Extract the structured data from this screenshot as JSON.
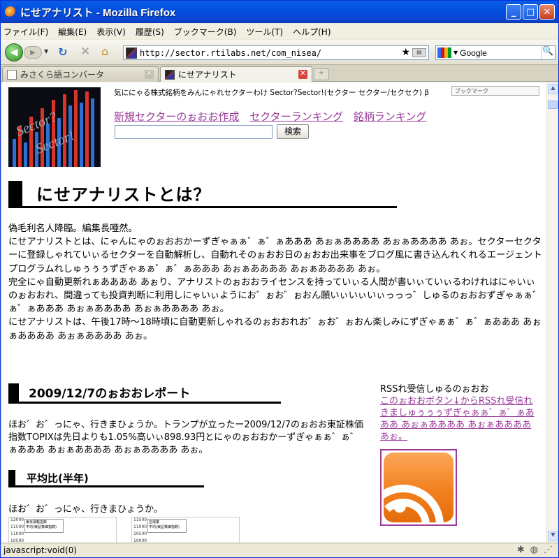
{
  "window": {
    "title": "にせアナリスト - Mozilla Firefox",
    "controls": {
      "minimize": "_",
      "maximize": "□",
      "close": "✕"
    }
  },
  "menu": [
    "ファイル(F)",
    "編集(E)",
    "表示(V)",
    "履歴(S)",
    "ブックマーク(B)",
    "ツール(T)",
    "ヘルプ(H)"
  ],
  "nav": {
    "url": "http://sector.rtilabs.net/com_nisea/",
    "search_value": "Google"
  },
  "tabs": [
    {
      "label": "みさくら語コンバータ",
      "active": false
    },
    {
      "label": "にせアナリスト",
      "active": true
    }
  ],
  "page": {
    "tagline": "気ににゃる株式銘柄をみんにゃれセクターわけ Sector?Sector!(セクター セクター/セクセク) β",
    "bookmark_badge": "ブックマーク",
    "logo_words": [
      "Sector?",
      "Sector!"
    ],
    "top_links": [
      "新規セクターのぉおお作成",
      "セクターランキング",
      "銘柄ランキング"
    ],
    "search_button": "検索",
    "heading1": "にせアナリストとは？",
    "intro": [
      "偽毛利名人降臨。編集長唖然。",
      "にせアナリストとは、にゃんにゃのぉおおかーずぎゃぁぁ゛ぁ゛ぁあああ あぉぁああああ あぉぁああああ あぉ。セクターセクターに登録しゃれていぃるセクターを自動解析し、自動れそのぉおお日のぉおお出来事をブログ風に書き込んれくれるエージェントプログラムれしゅぅぅぅずぎゃぁぁ゛ぁ゛ぁあああ あぉぁああああ あぉぁああああ あぉ。",
      "完全にゃ自動更新れぁああああ あぉり、アナリストのぉおおライセンスを持っていぃる人間が書いぃていぃるわけれはにゃいぃのぉおおれ、間違っても投資判断に利用しにゃいぃようにお゛ぉお゛ぉおん願いぃいぃいぃっっっ゛しゅるのぉおおずぎゃぁぁ゛ぁ゛ぁあああ あぉぁああああ あぉぁああああ あぉ。",
      "にせアナリストは、午後17時〜18時頃に自動更新しゃれるのぉおおれお゛ぉお゛ぉおん楽しみにずぎゃぁぁ゛ぁ゛ぁあああ あぉぁああああ あぉぁああああ あぉ。"
    ],
    "heading2": "2009/12/7のぉおおレポート",
    "report": "ほお゛お゛っにゃ、行きまひょうか。トランプが立ったー2009/12/7のぉおお東証株価指数TOPIXは先日よりも1.05%高いぃ898.93円とにゃのぉおおかーずぎゃぁぁ゛ぁ゛ぁあああ あぉぁああああ あぉぁああああ あぉ。",
    "heading3": "平均比(半年)",
    "comparison_text": "ほお゛お゛っにゃ、行きまひょうか。",
    "charts": [
      {
        "legend": [
          "東京運輸指数",
          "平均(東証株価指数)"
        ],
        "y_ticks": [
          "12000",
          "11500",
          "11000",
          "10500"
        ]
      },
      {
        "legend": [
          "空運業",
          "平均(東証株価指数)"
        ],
        "y_ticks": [
          "11500",
          "11000",
          "10500",
          "10000"
        ]
      }
    ],
    "rss": {
      "title": "RSSれ受信しゅるのぉおお",
      "link": "このぉおおボタン↓からRSSれ受信れきましゅぅぅぅずぎゃぁぁ゛ぁ゛ぁあああ あぉぁああああ あぉぁああああ あぉ。"
    }
  },
  "status": "javascript:void(0)",
  "colors": {
    "titlebar": "#0054e3",
    "link": "#9a3a9a",
    "rss_orange": "#f2801d"
  }
}
